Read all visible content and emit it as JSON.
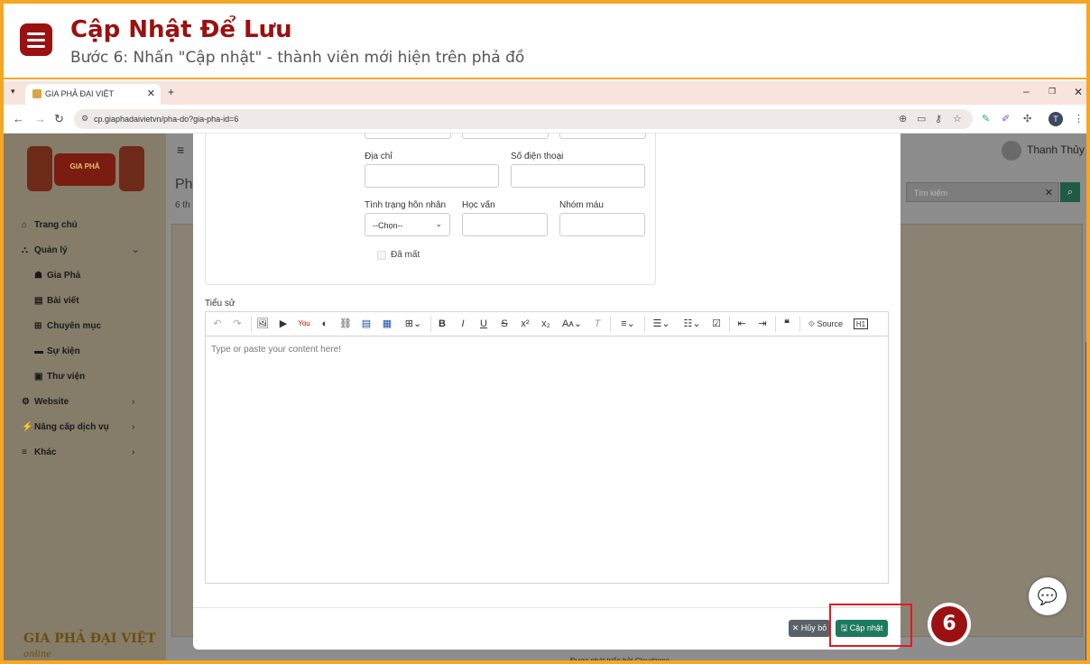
{
  "tutorial": {
    "title": "Cập Nhật Để Lưu",
    "subtitle": "Bước 6: Nhấn \"Cập nhật\" - thành viên mới hiện trên phả đồ",
    "step_number": "6"
  },
  "browser": {
    "tab_title": "GIA PHẢ ĐẠI VIỆT",
    "url": "cp.giaphadaivietvn/pha-do?gia-pha-id=6",
    "profile_initial": "T"
  },
  "app": {
    "user_name": "Thanh Thủy",
    "page_title_partial": "Phả",
    "page_sub_partial": "6 th",
    "search_placeholder": "Tìm kiếm",
    "footer": "Được phát triển bởi Cloudzone.",
    "logo_banner": "GIA PHẢ",
    "logo_bottom": "GIA PHẢ ĐẠI VIỆT",
    "logo_bottom_script": "online",
    "sidebar": [
      {
        "label": "Trang chủ",
        "icon": "home-icon"
      },
      {
        "label": "Quản lý",
        "icon": "sitemap-icon"
      },
      {
        "label": "Gia Phả",
        "icon": "users-icon"
      },
      {
        "label": "Bài viết",
        "icon": "newspaper-icon"
      },
      {
        "label": "Chuyên mục",
        "icon": "grid-icon"
      },
      {
        "label": "Sự kiện",
        "icon": "briefcase-icon"
      },
      {
        "label": "Thư viện",
        "icon": "images-icon"
      },
      {
        "label": "Website",
        "icon": "gear-icon"
      },
      {
        "label": "Nâng cấp dịch vụ",
        "icon": "chart-icon"
      },
      {
        "label": "Khác",
        "icon": "bars-icon"
      }
    ]
  },
  "form": {
    "address_label": "Địa chỉ",
    "phone_label": "Số điện thoại",
    "marital_label": "Tình trạng hôn nhân",
    "marital_value": "--Chọn--",
    "education_label": "Học vấn",
    "blood_label": "Nhóm máu",
    "deceased_label": "Đã mất",
    "bio_label": "Tiểu sử",
    "editor_placeholder": "Type or paste your content here!",
    "source_label": "Source"
  },
  "buttons": {
    "cancel": "✕ Hủy bỏ",
    "update": "🖫 Cập nhật"
  }
}
